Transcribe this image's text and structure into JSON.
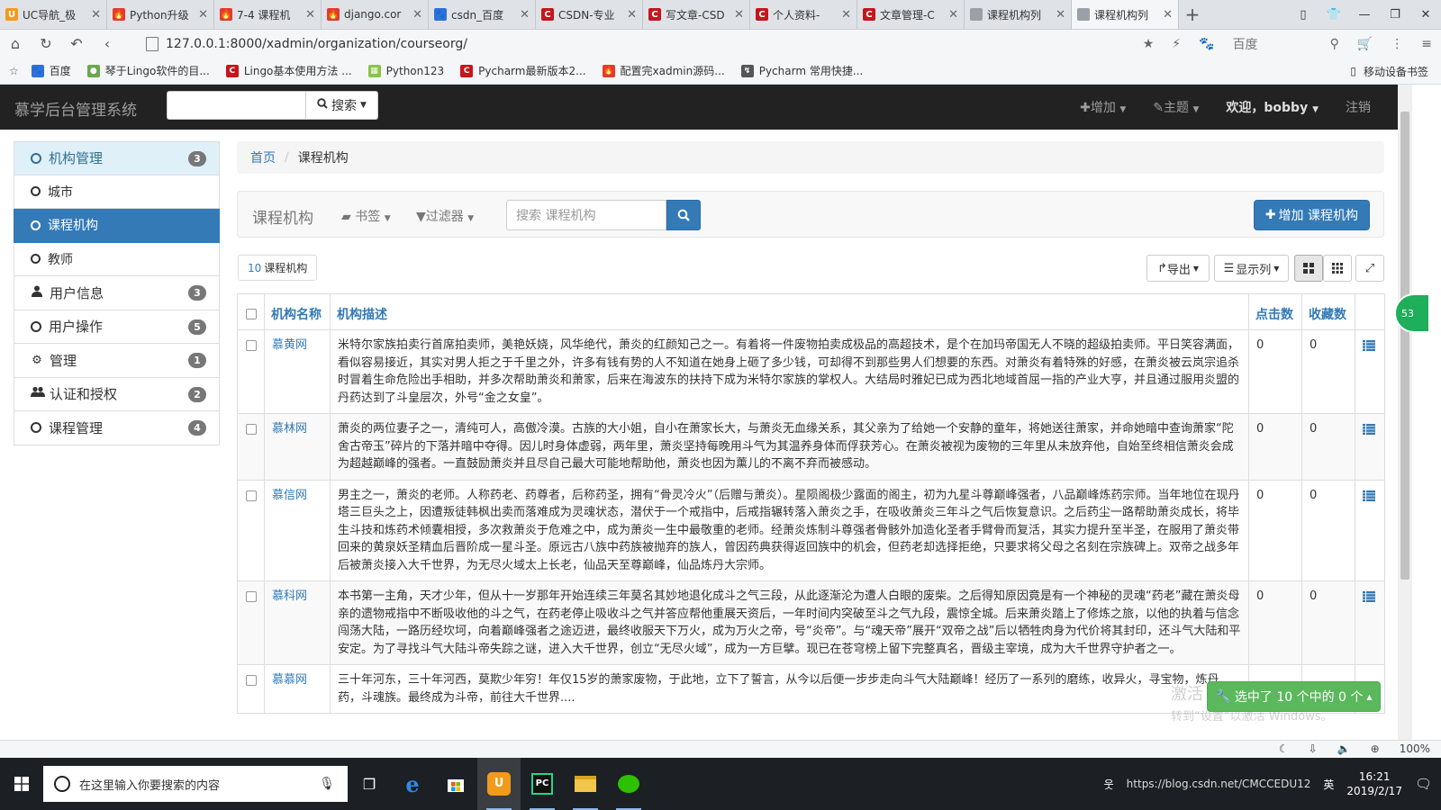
{
  "browser": {
    "tabs": [
      {
        "title": "UC导航_极",
        "color": "#f29a1b",
        "glyph": "U"
      },
      {
        "title": "Python升级",
        "color": "#e23b2e",
        "glyph": "🔥"
      },
      {
        "title": "7-4 课程机",
        "color": "#e23b2e",
        "glyph": "🔥"
      },
      {
        "title": "django.cor",
        "color": "#e23b2e",
        "glyph": "🔥"
      },
      {
        "title": "csdn_百度",
        "color": "#2f6fde",
        "glyph": "🐾"
      },
      {
        "title": "CSDN-专业",
        "color": "#c4161c",
        "glyph": "C"
      },
      {
        "title": "写文章-CSD",
        "color": "#c4161c",
        "glyph": "C"
      },
      {
        "title": "个人资料-",
        "color": "#c4161c",
        "glyph": "C"
      },
      {
        "title": "文章管理-C",
        "color": "#c4161c",
        "glyph": "C"
      },
      {
        "title": "课程机构列",
        "color": "#9aa0a6",
        "glyph": ""
      },
      {
        "title": "课程机构列",
        "color": "#9aa0a6",
        "glyph": ""
      }
    ],
    "url": "127.0.0.1:8000/xadmin/organization/courseorg/",
    "search_engine": "百度",
    "bookmarks": [
      "百度",
      "琴于Lingo软件的目...",
      "Lingo基本使用方法 ...",
      "Python123",
      "Pycharm最新版本2...",
      "配置完xadmin源码...",
      "Pycharm 常用快捷..."
    ],
    "mobile_bookmarks": "移动设备书签",
    "zoom": "100%"
  },
  "navbar": {
    "brand": "慕学后台管理系统",
    "search_button": "搜索",
    "add": "增加",
    "theme": "主题",
    "welcome": "欢迎，bobby",
    "logout": "注销"
  },
  "sidebar": {
    "items": [
      {
        "label": "机构管理",
        "badge": "3"
      },
      {
        "label": "城市"
      },
      {
        "label": "课程机构"
      },
      {
        "label": "教师"
      },
      {
        "label": "用户信息",
        "badge": "3"
      },
      {
        "label": "用户操作",
        "badge": "5"
      },
      {
        "label": "管理",
        "badge": "1"
      },
      {
        "label": "认证和授权",
        "badge": "2"
      },
      {
        "label": "课程管理",
        "badge": "4"
      }
    ]
  },
  "breadcrumb": {
    "home": "首页",
    "current": "课程机构"
  },
  "panel": {
    "title": "课程机构",
    "bookmarks": "书签",
    "filters": "过滤器",
    "search_placeholder": "搜索 课程机构",
    "add_button": "增加 课程机构"
  },
  "toolbar": {
    "count_num": "10",
    "count_label": "课程机构",
    "export": "导出",
    "columns": "显示列"
  },
  "table": {
    "headers": {
      "name": "机构名称",
      "desc": "机构描述",
      "clicks": "点击数",
      "favs": "收藏数"
    },
    "rows": [
      {
        "name": "慕黄网",
        "desc": "米特尔家族拍卖行首席拍卖师，美艳妖娆，风华绝代，萧炎的红颜知己之一。有着将一件废物拍卖成极品的高超技术，是个在加玛帝国无人不晓的超级拍卖师。平日笑容满面，看似容易接近，其实对男人拒之于千里之外，许多有钱有势的人不知道在她身上砸了多少钱，可却得不到那些男人们想要的东西。对萧炎有着特殊的好感，在萧炎被云岚宗追杀时冒着生命危险出手相助，并多次帮助萧炎和萧家，后来在海波东的扶持下成为米特尔家族的掌权人。大结局时雅妃已成为西北地域首屈一指的产业大亨，并且通过服用炎盟的丹药达到了斗皇层次，外号“金之女皇”。",
        "clicks": "0",
        "favs": "0"
      },
      {
        "name": "慕林网",
        "desc": "萧炎的两位妻子之一，清纯可人，高傲冷漠。古族的大小姐，自小在萧家长大，与萧炎无血缘关系，其父亲为了给她一个安静的童年，将她送往萧家，并命她暗中查询萧家“陀舍古帝玉”碎片的下落并暗中夺得。因儿时身体虚弱，两年里，萧炎坚持每晚用斗气为其温养身体而俘获芳心。在萧炎被视为废物的三年里从未放弃他，自始至终相信萧炎会成为超越巅峰的强者。一直鼓励萧炎并且尽自己最大可能地帮助他，萧炎也因为薰儿的不离不弃而被感动。",
        "clicks": "0",
        "favs": "0"
      },
      {
        "name": "慕信网",
        "desc": "男主之一，萧炎的老师。人称药老、药尊者，后称药圣，拥有“骨灵冷火”（后赠与萧炎）。星陨阁极少露面的阁主，初为九星斗尊巅峰强者，八品巅峰炼药宗师。当年地位在现丹塔三巨头之上，因遭叛徒韩枫出卖而落难成为灵魂状态，潜伏于一个戒指中，后戒指辗转落入萧炎之手，在吸收萧炎三年斗之气后恢复意识。之后药尘一路帮助萧炎成长，将毕生斗技和炼药术倾囊相授，多次救萧炎于危难之中，成为萧炎一生中最敬重的老师。经萧炎炼制斗尊强者骨骸外加造化圣者手臂骨而复活，其实力提升至半圣，在服用了萧炎带回来的黄泉妖圣精血后晋阶成一星斗圣。原远古八族中药族被抛弃的族人，曾因药典获得返回族中的机会，但药老却选择拒绝，只要求将父母之名刻在宗族碑上。双帝之战多年后被萧炎接入大千世界，为无尽火域太上长老，仙品天至尊巅峰，仙品炼丹大宗师。",
        "clicks": "0",
        "favs": "0"
      },
      {
        "name": "慕科网",
        "desc": "本书第一主角，天才少年，但从十一岁那年开始连续三年莫名其妙地退化成斗之气三段，从此逐渐沦为遭人白眼的废柴。之后得知原因竟是有一个神秘的灵魂“药老”藏在萧炎母亲的遗物戒指中不断吸收他的斗之气，在药老停止吸收斗之气并答应帮他重展天资后，一年时间内突破至斗之气九段，震惊全城。后来萧炎踏上了修炼之旅，以他的执着与信念闯荡大陆，一路历经坎坷，向着巅峰强者之途迈进，最终收服天下万火，成为万火之帝，号“炎帝”。与“魂天帝”展开“双帝之战”后以牺牲肉身为代价将其封印，还斗气大陆和平安定。为了寻找斗气大陆斗帝失踪之谜，进入大千世界，创立“无尽火域”，成为一方巨擘。现已在苍穹榜上留下完整真名，晋级主宰境，成为大千世界守护者之一。",
        "clicks": "0",
        "favs": "0"
      },
      {
        "name": "慕慕网",
        "desc": "三十年河东，三十年河西，莫欺少年穷！年仅15岁的萧家废物，于此地，立下了誓言，从今以后便一步步走向斗气大陆巅峰！经历了一系列的磨练，收异火，寻宝物，炼丹药，斗魂族。最终成为斗帝，前往大千世界....",
        "clicks": "",
        "favs": ""
      }
    ]
  },
  "selection": "选中了 10 个中的 0 个",
  "watermark": {
    "line1": "激活 Windows",
    "line2": "转到“设置”以激活 Windows。"
  },
  "float_badge": "53",
  "taskbar": {
    "search_placeholder": "在这里输入你要搜索的内容",
    "time": "16:21",
    "date": "2019/2/17",
    "ime": "英",
    "tray_text": "https://blog.csdn.net/CMCCEDU12"
  }
}
